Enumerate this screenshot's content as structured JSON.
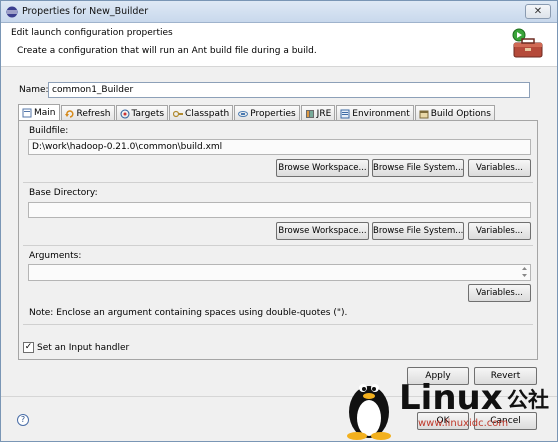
{
  "window": {
    "title": "Properties for New_Builder",
    "close_glyph": "✕"
  },
  "header": {
    "title": "Edit launch configuration properties",
    "description": "Create a configuration that will run an Ant build file during a build."
  },
  "name": {
    "label": "Name:",
    "value": "common1_Builder"
  },
  "tabs": [
    {
      "label": "Main",
      "icon": "main-tab-icon",
      "active": true
    },
    {
      "label": "Refresh",
      "icon": "refresh-icon"
    },
    {
      "label": "Targets",
      "icon": "targets-icon"
    },
    {
      "label": "Classpath",
      "icon": "classpath-icon"
    },
    {
      "label": "Properties",
      "icon": "properties-icon"
    },
    {
      "label": "JRE",
      "icon": "jre-icon"
    },
    {
      "label": "Environment",
      "icon": "environment-icon"
    },
    {
      "label": "Build Options",
      "icon": "build-options-icon"
    }
  ],
  "buildfile": {
    "label": "Buildfile:",
    "value": "D:\\work\\hadoop-0.21.0\\common\\build.xml",
    "browse_workspace": "Browse Workspace...",
    "browse_file_system": "Browse File System...",
    "variables": "Variables..."
  },
  "base_directory": {
    "label": "Base Directory:",
    "value": "",
    "browse_workspace": "Browse Workspace...",
    "browse_file_system": "Browse File System...",
    "variables": "Variables..."
  },
  "arguments": {
    "label": "Arguments:",
    "value": "",
    "variables": "Variables...",
    "note": "Note: Enclose an argument containing spaces using double-quotes (\")."
  },
  "input_handler": {
    "label": "Set an Input handler",
    "checked": true,
    "check_glyph": "✓"
  },
  "buttons": {
    "apply": "Apply",
    "revert": "Revert",
    "ok": "OK",
    "cancel": "Cancel"
  },
  "help": {
    "glyph": "?"
  },
  "watermark": {
    "brand": "Linux",
    "suffix": "公社",
    "url": "www.linuxidc.com"
  },
  "colors": {
    "watermark_url": "#c0392b",
    "header_bg": "#ffffff",
    "window_bg": "#f0f0f0"
  }
}
